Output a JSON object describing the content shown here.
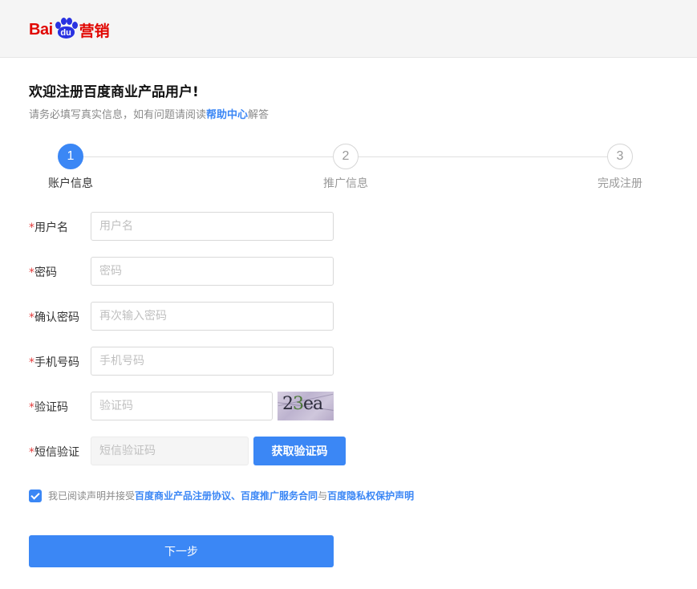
{
  "header": {
    "logo": {
      "bai": "Bai",
      "du": "du",
      "suffix": "营销"
    }
  },
  "intro": {
    "title": "欢迎注册百度商业产品用户!",
    "subtitle_prefix": "请务必填写真实信息，如有问题请阅读",
    "help_link": "帮助中心",
    "subtitle_suffix": "解答"
  },
  "steps": [
    {
      "number": "1",
      "label": "账户信息",
      "active": true
    },
    {
      "number": "2",
      "label": "推广信息",
      "active": false
    },
    {
      "number": "3",
      "label": "完成注册",
      "active": false
    }
  ],
  "form": {
    "required_mark": "*",
    "username": {
      "label": "用户名",
      "placeholder": "用户名",
      "value": ""
    },
    "password": {
      "label": "密码",
      "placeholder": "密码",
      "value": ""
    },
    "confirm_password": {
      "label": "确认密码",
      "placeholder": "再次输入密码",
      "value": ""
    },
    "phone": {
      "label": "手机号码",
      "placeholder": "手机号码",
      "value": ""
    },
    "captcha": {
      "label": "验证码",
      "placeholder": "验证码",
      "value": "",
      "image_text_a": "2",
      "image_text_b": "3",
      "image_text_c": "ea"
    },
    "sms": {
      "label": "短信验证",
      "placeholder": "短信验证码",
      "value": "",
      "button_label": "获取验证码"
    }
  },
  "agreement": {
    "checked": true,
    "prefix": "我已阅读声明并接受",
    "link1": "百度商业产品注册协议",
    "sep": "、",
    "link2": "百度推广服务合同",
    "and": "与",
    "link3": "百度隐私权保护声明"
  },
  "next_button": "下一步",
  "colors": {
    "primary": "#3b87f5",
    "required": "#e33b3b",
    "brand_red": "#e10601",
    "brand_blue": "#2932e1"
  }
}
